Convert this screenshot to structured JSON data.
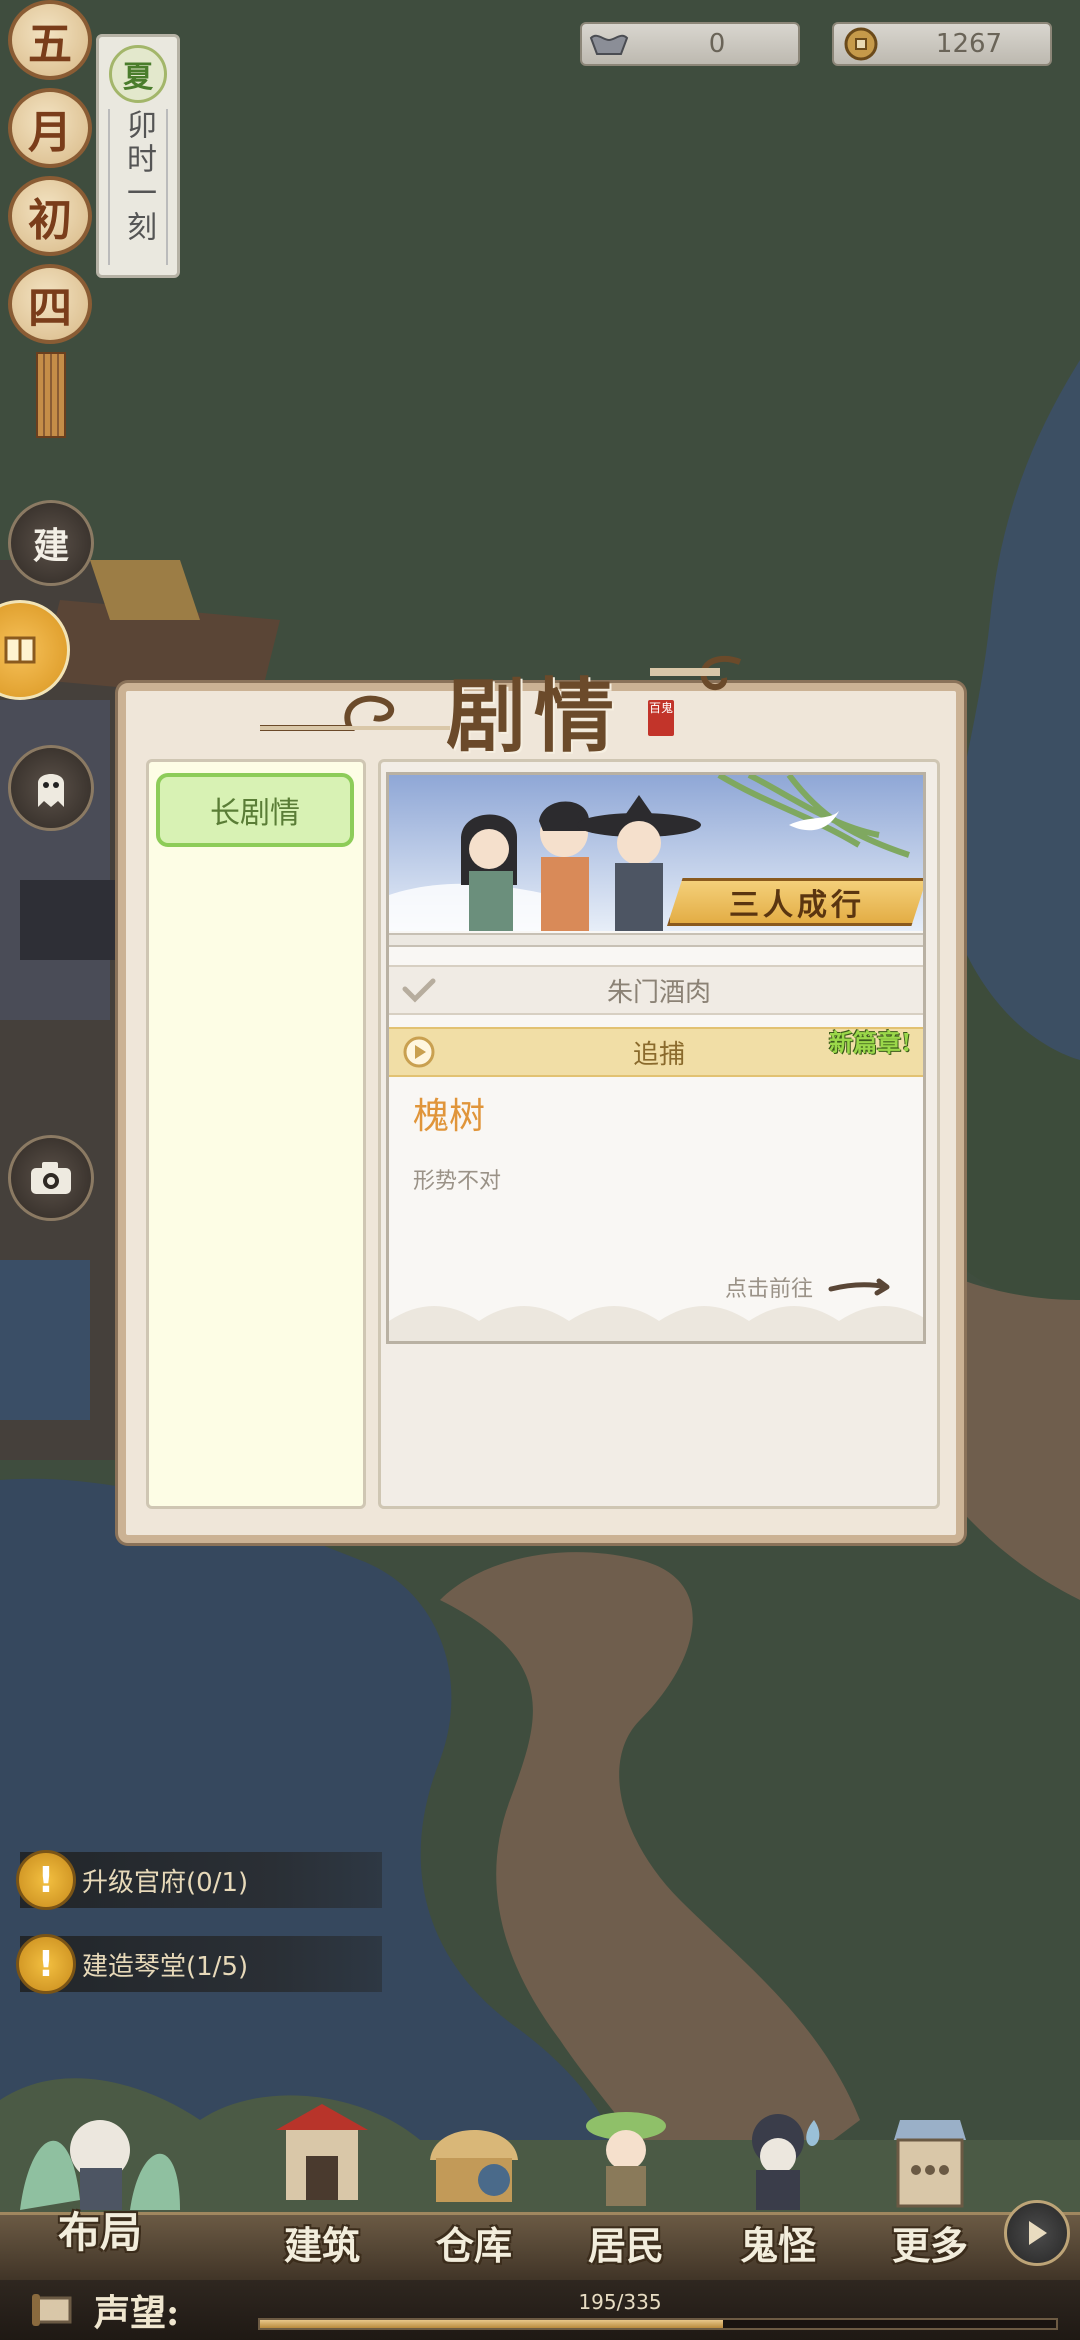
{
  "currencies": [
    {
      "icon": "silver-ingot-icon",
      "value": "0"
    },
    {
      "icon": "copper-coin-icon",
      "value": "1267"
    }
  ],
  "calendar": {
    "month_day_chars": [
      "五",
      "月",
      "初",
      "四"
    ],
    "season": "夏",
    "time": "卯时一刻"
  },
  "side_buttons": [
    {
      "name": "build-mode-button",
      "glyph": "建"
    },
    {
      "name": "ghost-button",
      "glyph": ""
    },
    {
      "name": "camera-button",
      "glyph": ""
    }
  ],
  "quests": [
    {
      "text": "升级官府(0/1)"
    },
    {
      "text": "建造琴堂(1/5)"
    }
  ],
  "story_dialog": {
    "title": "剧情",
    "title_seal": "百鬼",
    "tab_label": "长剧情",
    "banner_title": "三人成行",
    "chapters": [
      {
        "label": "朱门酒肉",
        "state": "done"
      },
      {
        "label": "追捕",
        "state": "current",
        "badge": "新篇章!"
      }
    ],
    "current_section": {
      "title": "槐树",
      "description": "形势不对",
      "go_label": "点击前往"
    }
  },
  "bottom_nav": [
    {
      "label": "布局"
    },
    {
      "label": "建筑"
    },
    {
      "label": "仓库"
    },
    {
      "label": "居民"
    },
    {
      "label": "鬼怪"
    },
    {
      "label": "更多"
    }
  ],
  "reputation": {
    "label": "声望:",
    "current": 195,
    "max": 335,
    "text": "195/335"
  },
  "colors": {
    "accent_green": "#8dcc58",
    "accent_orange": "#e0953a",
    "panel_bg": "#efe6d9",
    "map_land": "#3f4d3e",
    "map_water": "#34495e",
    "map_road": "#6b5a4a"
  }
}
